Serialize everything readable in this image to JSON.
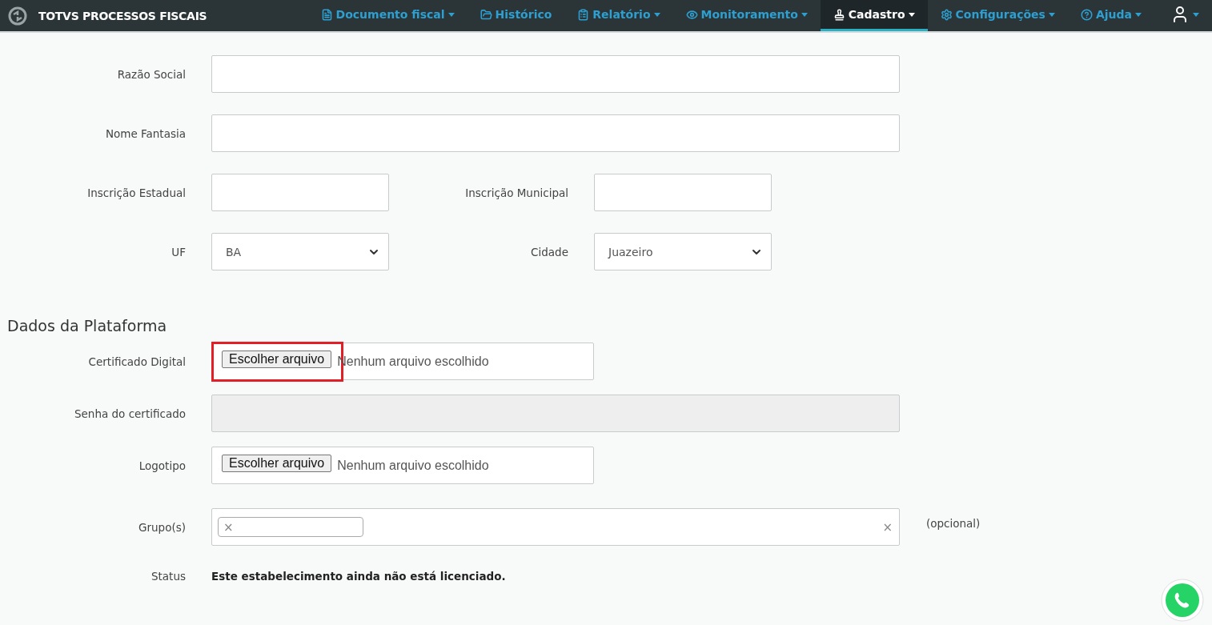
{
  "navbar": {
    "brand": "TOTVS PROCESSOS FISCAIS",
    "items": [
      {
        "label": "Documento fiscal",
        "dropdown": true,
        "selected": false
      },
      {
        "label": "Histórico",
        "dropdown": false,
        "selected": false
      },
      {
        "label": "Relatório",
        "dropdown": true,
        "selected": false
      },
      {
        "label": "Monitoramento",
        "dropdown": true,
        "selected": false
      },
      {
        "label": "Cadastro",
        "dropdown": true,
        "selected": true
      },
      {
        "label": "Configurações",
        "dropdown": true,
        "selected": false
      },
      {
        "label": "Ajuda",
        "dropdown": true,
        "selected": false
      }
    ],
    "user_menu": {
      "dropdown": true
    }
  },
  "sections": [
    {
      "rows": [
        {
          "fields": [
            {
              "kind": "text",
              "label": "Razão Social",
              "disabled": false
            }
          ]
        },
        {
          "fields": [
            {
              "kind": "text",
              "label": "Nome Fantasia",
              "disabled": false
            }
          ]
        },
        {
          "fields": [
            {
              "kind": "text",
              "label": "Inscrição Estadual",
              "disabled": false
            },
            {
              "kind": "text",
              "label": "Inscrição Municipal",
              "disabled": false
            }
          ]
        },
        {
          "fields": [
            {
              "kind": "select",
              "label": "UF",
              "value": "BA"
            },
            {
              "kind": "select",
              "label": "Cidade",
              "value": "Juazeiro"
            }
          ]
        }
      ]
    },
    {
      "heading": "Dados da Plataforma",
      "rows": [
        {
          "fields": [
            {
              "kind": "file",
              "label": "Certificado Digital",
              "button": "Escolher arquivo",
              "status": "Nenhum arquivo escolhido",
              "highlighted": true
            }
          ]
        },
        {
          "fields": [
            {
              "kind": "text",
              "label": "Senha do certificado",
              "disabled": true
            }
          ]
        },
        {
          "fields": [
            {
              "kind": "file",
              "label": "Logotipo",
              "button": "Escolher arquivo",
              "status": "Nenhum arquivo escolhido",
              "highlighted": false
            }
          ]
        },
        {
          "fields": [
            {
              "kind": "tags",
              "label": "Grupo(s)",
              "tags": [
                {
                  "remove": "×"
                }
              ],
              "clear": "×",
              "note": "(opcional)"
            }
          ]
        },
        {
          "fields": [
            {
              "kind": "static",
              "label": "Status",
              "value": "Este estabelecimento ainda não está licenciado."
            }
          ]
        }
      ]
    }
  ]
}
